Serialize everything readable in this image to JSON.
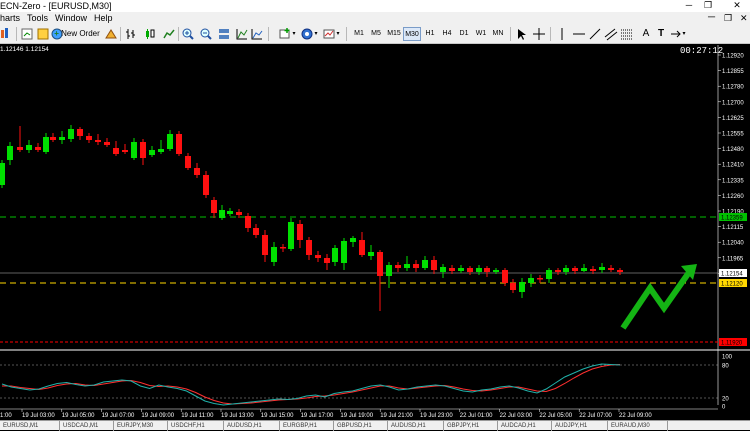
{
  "app": {
    "title": "ECN-Zero - [EURUSD,M30]"
  },
  "menu": {
    "items": [
      "harts",
      "Tools",
      "Window",
      "Help"
    ]
  },
  "toolbar": {
    "new_order_label": "New Order",
    "timeframes": [
      "M1",
      "M5",
      "M15",
      "M30",
      "H1",
      "H4",
      "D1",
      "W1",
      "MN"
    ],
    "active_timeframe": "M30",
    "text_tool_label": "A",
    "text_label_tool_label": "T"
  },
  "chart": {
    "symbol_info": "1.12146 1.12154",
    "countdown": "00:27:12",
    "colors": {
      "background": "#000000",
      "bull": "#00e000",
      "bear": "#ff1010",
      "price_lines_green": "#00c000",
      "bid_line": "#c0c0c0",
      "ask_line": "#ffd700",
      "red_line": "#ff0000",
      "arrow": "#14b414",
      "stoch_main": "#20b2aa",
      "stoch_signal": "#ff3030"
    },
    "price_labels": [
      "1.12920",
      "1.12855",
      "1.12780",
      "1.12700",
      "1.12625",
      "1.12555",
      "1.12480",
      "1.12410",
      "1.12335",
      "1.12260",
      "1.12190",
      "1.12115",
      "1.12040",
      "1.11965",
      "1.11895"
    ],
    "time_labels": [
      "19 Jul 03:00",
      "19 Jul 05:00",
      "19 Jul 07:00",
      "19 Jul 09:00",
      "19 Jul 11:00",
      "19 Jul 13:00",
      "19 Jul 15:00",
      "19 Jul 17:00",
      "19 Jul 19:00",
      "19 Jul 21:00",
      "19 Jul 23:00",
      "22 Jul 01:00",
      "22 Jul 03:00",
      "22 Jul 05:00",
      "22 Jul 07:00",
      "22 Jul 09:00"
    ],
    "first_time_fragment": "1:00",
    "levels": {
      "green_line": "1.12359",
      "bid": "1.12154",
      "ask_yellow": "1.12120",
      "red_line": "1.11920"
    },
    "stoch_labels": [
      "100",
      "80",
      "20",
      "0"
    ]
  },
  "tabs": [
    "EURUSD,M1",
    "USDCAD,M1",
    "EURJPY,M30",
    "USDCHF,H1",
    "AUDUSD,H1",
    "EURGBP,H1",
    "GBPUSD,H1",
    "AUDUSD,H1",
    "GBPJPY,H1",
    "AUDCAD,H1",
    "AUDJPY,H1",
    "EURAUD,M30"
  ]
}
